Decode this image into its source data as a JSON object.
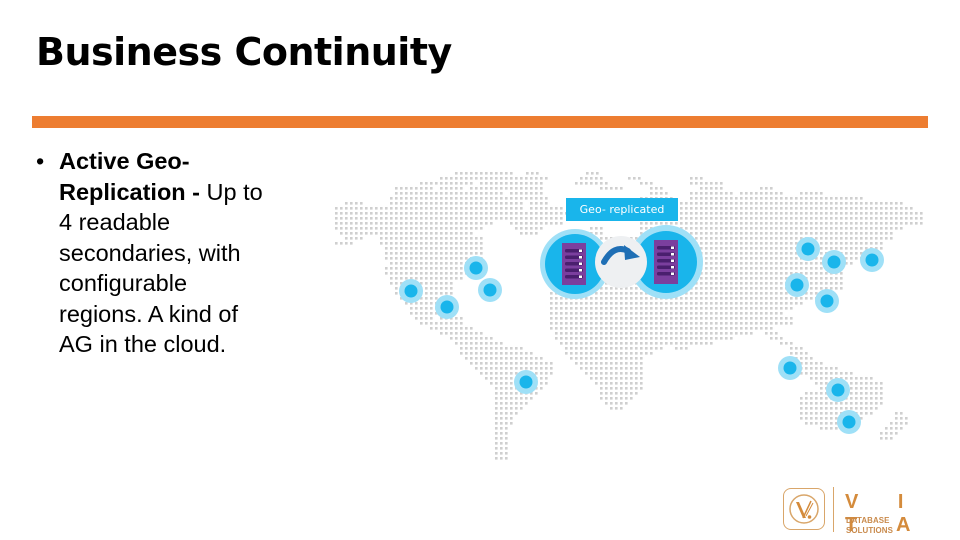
{
  "slide": {
    "title": "Business Continuity",
    "accent_color": "#ED7D31"
  },
  "bullets": [
    {
      "bold": "Active Geo-Replication - ",
      "lines": [
        {
          "bold": "Active Geo-",
          "normal": ""
        },
        {
          "bold": "Replication - ",
          "normal": "Up to"
        },
        {
          "bold": "",
          "normal": "4 readable"
        },
        {
          "bold": "",
          "normal": "secondaries, with"
        },
        {
          "bold": "",
          "normal": "configurable"
        },
        {
          "bold": "",
          "normal": "regions. A kind of"
        },
        {
          "bold": "",
          "normal": "AG in the cloud."
        }
      ]
    }
  ],
  "diagram": {
    "label": "Geo- replicated",
    "label_color": "#19B5EB",
    "server_color": "#7B3F9E",
    "marker_color": "#19B5EB",
    "arrow_color": "#1F6FB5",
    "icons": [
      "world-map",
      "primary-database-server",
      "replication-arrow",
      "secondary-database-server",
      "region-marker"
    ],
    "region_marker_count": 13
  },
  "logo": {
    "name": "V I T A",
    "subtitle": "DATABASE SOLUTIONS",
    "color": "#D48B3C"
  }
}
